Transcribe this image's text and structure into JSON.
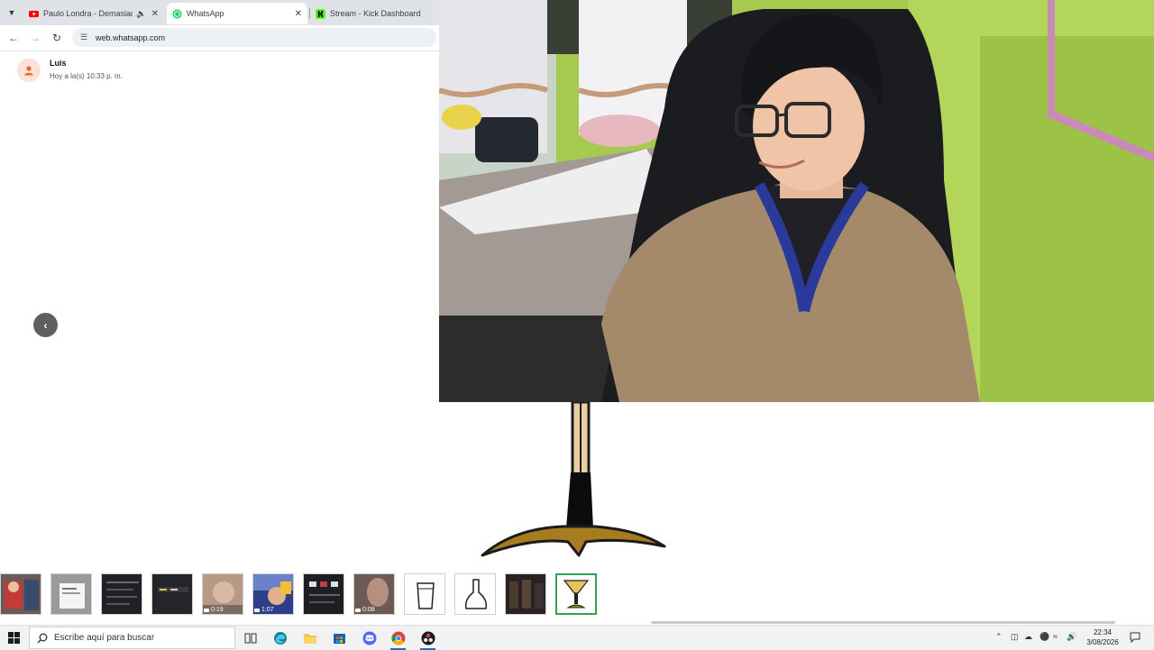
{
  "browser": {
    "tabs": [
      {
        "title": "Paulo Londra - Demasiado",
        "icon": "youtube-icon",
        "extra": "speaker-icon",
        "active": false
      },
      {
        "title": "WhatsApp",
        "icon": "whatsapp-icon",
        "active": true
      },
      {
        "title": "Stream - Kick Dashboard",
        "icon": "kick-icon",
        "active": false
      }
    ],
    "address": "web.whatsapp.com"
  },
  "notification": {
    "name": "Luis",
    "time": "Hoy a la(s) 10:33 p. m."
  },
  "tray": {
    "thumbnails": [
      {
        "kind": "photo",
        "duration": ""
      },
      {
        "kind": "document",
        "duration": ""
      },
      {
        "kind": "dark-screen",
        "duration": ""
      },
      {
        "kind": "dark-screen",
        "duration": ""
      },
      {
        "kind": "video",
        "duration": "0:19"
      },
      {
        "kind": "video",
        "duration": "1:07"
      },
      {
        "kind": "dark-screen",
        "duration": ""
      },
      {
        "kind": "video",
        "duration": "0:08"
      },
      {
        "kind": "glass-drawing",
        "duration": ""
      },
      {
        "kind": "bottle-drawing",
        "duration": ""
      },
      {
        "kind": "dark-photo",
        "duration": ""
      },
      {
        "kind": "cocktail-drawing",
        "duration": "",
        "selected": true
      }
    ]
  },
  "taskbar": {
    "search_placeholder": "Escribe aquí para buscar",
    "clock_time": "22:34",
    "clock_date": "3/08/2026",
    "colors": {
      "accent": "#2b6cb0",
      "discord": "#5865f2",
      "edge": "#0c8a8f"
    }
  }
}
